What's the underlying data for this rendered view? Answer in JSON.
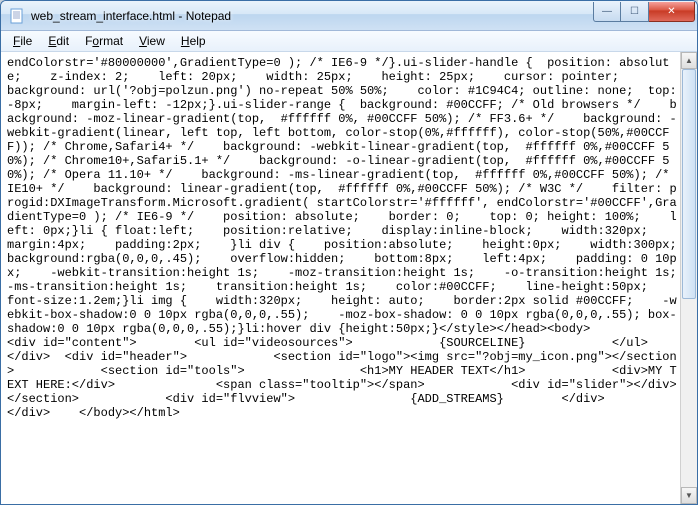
{
  "window": {
    "title": "web_stream_interface.html - Notepad"
  },
  "menu": {
    "file": "File",
    "edit": "Edit",
    "format": "Format",
    "view": "View",
    "help": "Help"
  },
  "buttons": {
    "min": "—",
    "max": "☐",
    "close": "✕"
  },
  "scroll": {
    "up": "▲",
    "down": "▼"
  },
  "content": "endColorstr='#80000000',GradientType=0 ); /* IE6-9 */}.ui-slider-handle {  position: absolute;    z-index: 2;    left: 20px;    width: 25px;    height: 25px;    cursor: pointer;        background: url('?obj=polzun.png') no-repeat 50% 50%;    color: #1C94C4; outline: none;  top: -8px;    margin-left: -12px;}.ui-slider-range {  background: #00CCFF; /* Old browsers */    background: -moz-linear-gradient(top,  #ffffff 0%, #00CCFF 50%); /* FF3.6+ */    background: -webkit-gradient(linear, left top, left bottom, color-stop(0%,#ffffff), color-stop(50%,#00CCFF)); /* Chrome,Safari4+ */    background: -webkit-linear-gradient(top,  #ffffff 0%,#00CCFF 50%); /* Chrome10+,Safari5.1+ */    background: -o-linear-gradient(top,  #ffffff 0%,#00CCFF 50%); /* Opera 11.10+ */    background: -ms-linear-gradient(top,  #ffffff 0%,#00CCFF 50%); /* IE10+ */    background: linear-gradient(top,  #ffffff 0%,#00CCFF 50%); /* W3C */    filter: progid:DXImageTransform.Microsoft.gradient( startColorstr='#ffffff', endColorstr='#00CCFF',GradientType=0 ); /* IE6-9 */    position: absolute;    border: 0;    top: 0; height: 100%;    left: 0px;}li { float:left;    position:relative;    display:inline-block;    width:320px;    margin:4px;    padding:2px;    }li div {    position:absolute;    height:0px;    width:300px;    background:rgba(0,0,0,.45);    overflow:hidden;    bottom:8px;    left:4px;    padding: 0 10px;    -webkit-transition:height 1s;    -moz-transition:height 1s;    -o-transition:height 1s;    -ms-transition:height 1s;    transition:height 1s;    color:#00CCFF;    line-height:50px;    font-size:1.2em;}li img {    width:320px;    height: auto;    border:2px solid #00CCFF;    -webkit-box-shadow:0 0 10px rgba(0,0,0,.55);    -moz-box-shadow: 0 0 10px rgba(0,0,0,.55); box-shadow:0 0 10px rgba(0,0,0,.55);}li:hover div {height:50px;}</style></head><body>            <div id=\"content\">        <ul id=\"videosources\">            {SOURCELINE}            </ul>    </div>  <div id=\"header\">            <section id=\"logo\"><img src=\"?obj=my_icon.png\"></section>            <section id=\"tools\">                <h1>MY HEADER TEXT</h1>            <div>MY TEXT HERE:</div>              <span class=\"tooltip\"></span>            <div id=\"slider\"></div>            </section>            <div id=\"flvview\">                {ADD_STREAMS}        </div>                </div>    </body></html>"
}
